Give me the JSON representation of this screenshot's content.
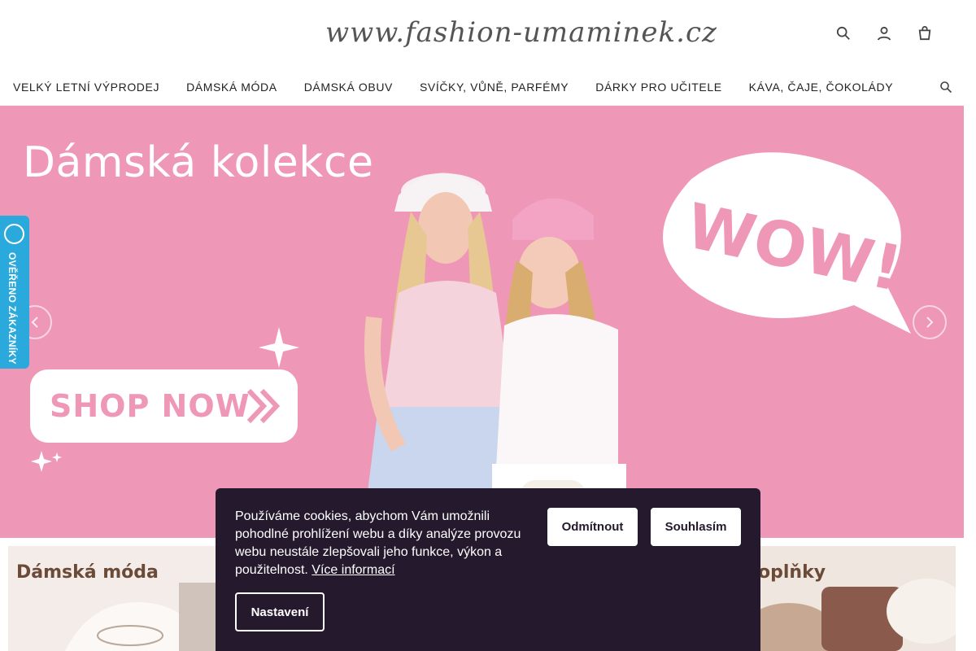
{
  "header": {
    "logo_text": "www.fashion-umaminek.cz",
    "icons": [
      "search-icon",
      "user-icon",
      "cart-icon"
    ]
  },
  "nav": {
    "items": [
      "VELKÝ LETNÍ VÝPRODEJ",
      "DÁMSKÁ MÓDA",
      "DÁMSKÁ OBUV",
      "SVÍČKY, VŮNĚ, PARFÉMY",
      "DÁRKY PRO UČITELE",
      "KÁVA, ČAJE, ČOKOLÁDY"
    ]
  },
  "hero": {
    "title": "Dámská kolekce",
    "bubble_text": "WOW!",
    "cta_label": "SHOP NOW",
    "background_color": "#ef97b6"
  },
  "verified_badge": {
    "label": "OVĚŘENO ZÁKAZNÍKY",
    "color": "#2aa9dc"
  },
  "tiles": {
    "left_label": "Dámská móda",
    "right_label": "oplňky"
  },
  "cookie": {
    "text": "Používáme cookies, abychom Vám umožnili pohodlné prohlížení webu a díky analýze provozu webu neustále zlepšovali jeho funkce, výkon a použitelnost.",
    "link_label": "Více informací",
    "reject_label": "Odmítnout",
    "accept_label": "Souhlasím",
    "settings_label": "Nastavení",
    "background_color": "#251a2d"
  }
}
